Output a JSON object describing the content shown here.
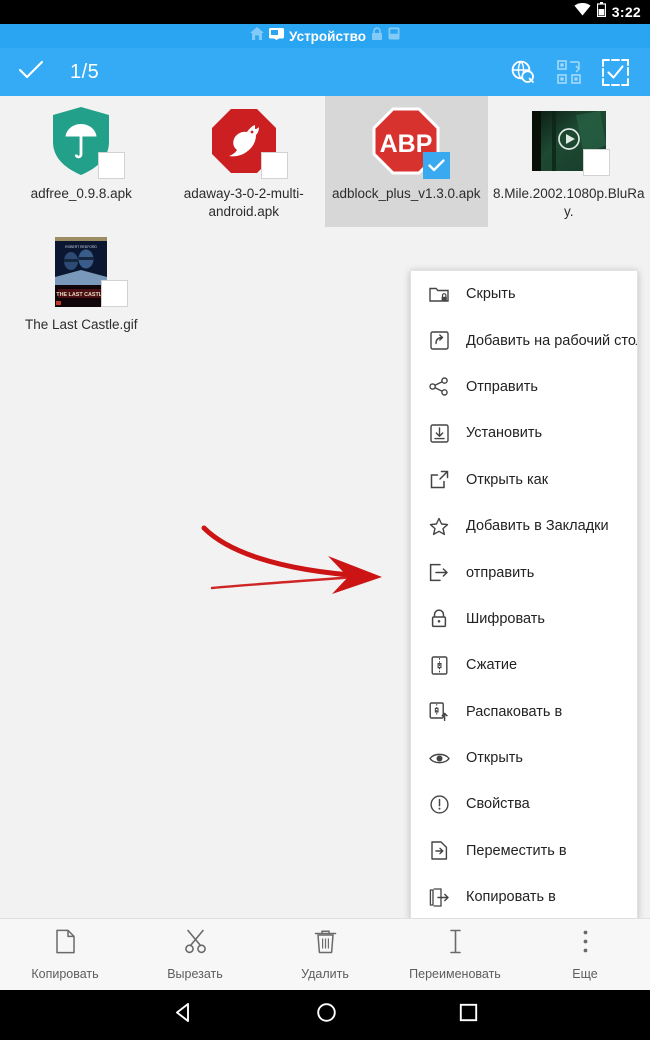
{
  "status_bar": {
    "time": "3:22",
    "icons": [
      "wifi-icon",
      "battery-icon"
    ]
  },
  "breadcrumb": {
    "home_icon": "home-icon",
    "device_icon": "sdcard-icon",
    "label": "Устройство",
    "trailing_icons": [
      "lock-icon",
      "storage-icon"
    ]
  },
  "action_bar": {
    "check_icon": "checkmark-icon",
    "count": "1/5",
    "icons": [
      {
        "name": "search-globe-icon"
      },
      {
        "name": "qr-transfer-icon"
      },
      {
        "name": "select-all-icon"
      }
    ]
  },
  "files": [
    {
      "name": "adfree_0.9.8.apk",
      "icon": "shield-umbrella-icon",
      "selected": false
    },
    {
      "name": "adaway-3-0-2-multi-android.apk",
      "icon": "octagon-dove-icon",
      "selected": false
    },
    {
      "name": "adblock_plus_v1.3.0.apk",
      "icon": "adblock-plus-icon",
      "selected": true
    },
    {
      "name": "8.Mile.2002.1080p.BluRay.",
      "icon": "video-thumbnail",
      "selected": false
    },
    {
      "name": "The Last Castle.gif",
      "icon": "movie-poster-thumbnail",
      "selected": false
    }
  ],
  "context_menu": {
    "items": [
      {
        "label": "Скрыть",
        "icon": "folder-lock-icon"
      },
      {
        "label": "Добавить на рабочий стол",
        "icon": "add-shortcut-icon"
      },
      {
        "label": "Отправить",
        "icon": "share-icon"
      },
      {
        "label": "Установить",
        "icon": "install-icon"
      },
      {
        "label": "Открыть как",
        "icon": "open-external-icon"
      },
      {
        "label": "Добавить в Закладки",
        "icon": "star-icon"
      },
      {
        "label": "отправить",
        "icon": "send-out-icon"
      },
      {
        "label": "Шифровать",
        "icon": "lock-icon"
      },
      {
        "label": "Сжатие",
        "icon": "zip-icon"
      },
      {
        "label": "Распаковать в",
        "icon": "unzip-icon"
      },
      {
        "label": "Открыть",
        "icon": "eye-icon"
      },
      {
        "label": "Свойства",
        "icon": "info-icon"
      },
      {
        "label": "Переместить в",
        "icon": "move-to-icon"
      },
      {
        "label": "Копировать в",
        "icon": "copy-to-icon"
      }
    ]
  },
  "annotation": {
    "arrow": "red-arrow-pointing-right",
    "color": "#cc1414"
  },
  "bottom_bar": {
    "items": [
      {
        "label": "Копировать",
        "icon": "copy-icon"
      },
      {
        "label": "Вырезать",
        "icon": "scissors-icon"
      },
      {
        "label": "Удалить",
        "icon": "trash-icon"
      },
      {
        "label": "Переименовать",
        "icon": "text-cursor-icon"
      },
      {
        "label": "Еще",
        "icon": "overflow-menu-icon"
      }
    ]
  },
  "nav_bar": {
    "items": [
      {
        "name": "back-button"
      },
      {
        "name": "home-button"
      },
      {
        "name": "recents-button"
      }
    ]
  },
  "colors": {
    "accent": "#35abf5",
    "breadcrumb": "#29a5f2",
    "selected_cell": "#d7d7d7",
    "file_area": "#f2f2f2"
  }
}
